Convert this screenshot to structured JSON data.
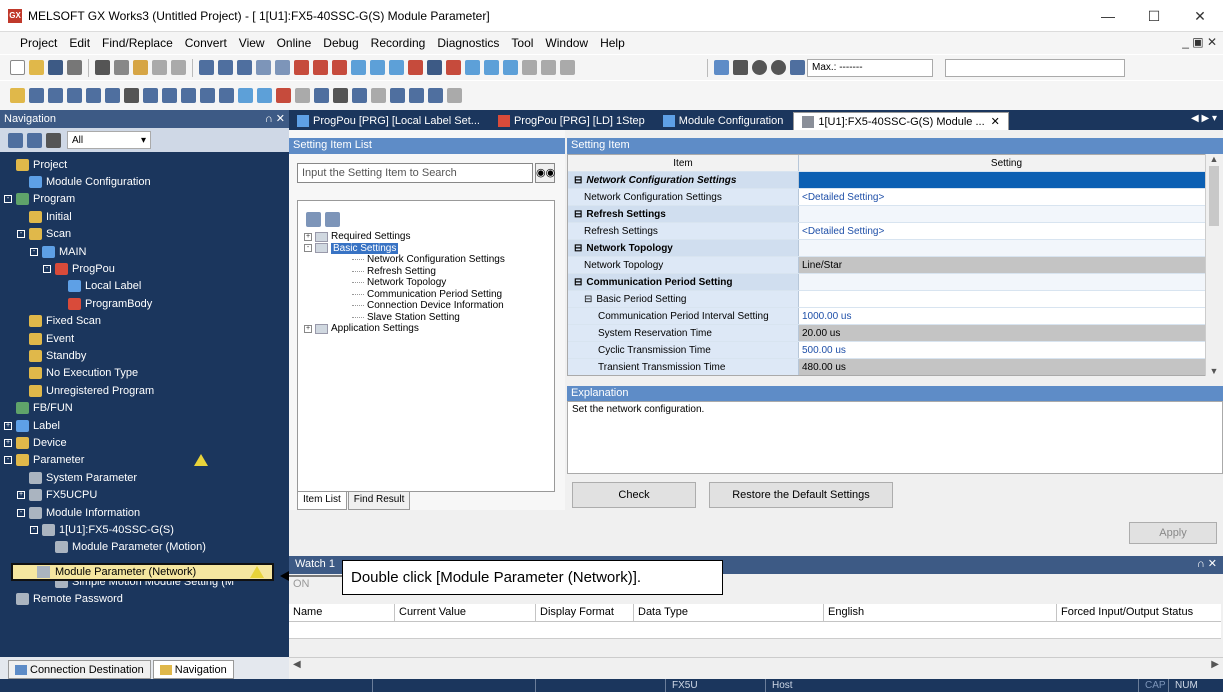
{
  "window": {
    "title": "MELSOFT GX Works3 (Untitled Project) - [ 1[U1]:FX5-40SSC-G(S) Module Parameter]",
    "app_icon": "GX"
  },
  "menu": [
    "Project",
    "Edit",
    "Find/Replace",
    "Convert",
    "View",
    "Online",
    "Debug",
    "Recording",
    "Diagnostics",
    "Tool",
    "Window",
    "Help"
  ],
  "toolbar": {
    "max_label": "Max.: -------"
  },
  "navigation": {
    "title": "Navigation",
    "filter": "All",
    "tree": [
      {
        "label": "Project",
        "level": 0
      },
      {
        "label": "Module Configuration",
        "level": 1
      },
      {
        "label": "Program",
        "level": 0,
        "exp": "-"
      },
      {
        "label": "Initial",
        "level": 1
      },
      {
        "label": "Scan",
        "level": 1,
        "exp": "-"
      },
      {
        "label": "MAIN",
        "level": 2,
        "exp": "-"
      },
      {
        "label": "ProgPou",
        "level": 3,
        "exp": "-"
      },
      {
        "label": "Local Label",
        "level": 4
      },
      {
        "label": "ProgramBody",
        "level": 4
      },
      {
        "label": "Fixed Scan",
        "level": 1
      },
      {
        "label": "Event",
        "level": 1
      },
      {
        "label": "Standby",
        "level": 1
      },
      {
        "label": "No Execution Type",
        "level": 1
      },
      {
        "label": "Unregistered Program",
        "level": 1
      },
      {
        "label": "FB/FUN",
        "level": 0
      },
      {
        "label": "Label",
        "level": 0,
        "exp": "+"
      },
      {
        "label": "Device",
        "level": 0,
        "exp": "+"
      },
      {
        "label": "Parameter",
        "level": 0,
        "exp": "-",
        "warn": true
      },
      {
        "label": "System Parameter",
        "level": 1
      },
      {
        "label": "FX5UCPU",
        "level": 1,
        "exp": "+"
      },
      {
        "label": "Module Information",
        "level": 1,
        "exp": "-"
      },
      {
        "label": "1[U1]:FX5-40SSC-G(S)",
        "level": 2,
        "exp": "-"
      },
      {
        "label": "Module Parameter (Motion)",
        "level": 3
      },
      {
        "label": "",
        "level": 3
      },
      {
        "label": "Simple Motion Module Setting (M",
        "level": 3
      },
      {
        "label": "Remote Password",
        "level": 0
      }
    ],
    "highlighted": "Module Parameter (Network)",
    "bottom_tabs": [
      "Connection Destination",
      "Navigation"
    ]
  },
  "doc_tabs": [
    {
      "label": "ProgPou [PRG] [Local Label Set..."
    },
    {
      "label": "ProgPou [PRG] [LD] 1Step"
    },
    {
      "label": "Module Configuration"
    },
    {
      "label": "1[U1]:FX5-40SSC-G(S) Module ...",
      "active": true
    }
  ],
  "setting_item_list": {
    "title": "Setting Item List",
    "search_placeholder": "Input the Setting Item to Search",
    "tree": [
      {
        "label": "Required Settings",
        "level": 0,
        "exp": "+"
      },
      {
        "label": "Basic Settings",
        "level": 0,
        "exp": "-",
        "selected": true
      },
      {
        "label": "Network Configuration Settings",
        "level": 1
      },
      {
        "label": "Refresh Setting",
        "level": 1
      },
      {
        "label": "Network Topology",
        "level": 1
      },
      {
        "label": "Communication Period Setting",
        "level": 1
      },
      {
        "label": "Connection Device Information",
        "level": 1
      },
      {
        "label": "Slave Station Setting",
        "level": 1
      },
      {
        "label": "Application Settings",
        "level": 0,
        "exp": "+"
      }
    ],
    "tabs": [
      "Item List",
      "Find Result"
    ]
  },
  "setting_item": {
    "title": "Setting Item",
    "col_item": "Item",
    "col_setting": "Setting",
    "rows": [
      {
        "item": "Network Configuration Settings",
        "setting": "",
        "type": "grp",
        "italic": true,
        "sel": true
      },
      {
        "item": "Network Configuration Settings",
        "setting": "<Detailed Setting>",
        "type": "sub"
      },
      {
        "item": "Refresh Settings",
        "setting": "",
        "type": "grp"
      },
      {
        "item": "Refresh Settings",
        "setting": "<Detailed Setting>",
        "type": "sub"
      },
      {
        "item": "Network Topology",
        "setting": "",
        "type": "grp"
      },
      {
        "item": "Network Topology",
        "setting": "Line/Star",
        "type": "sub",
        "gray": true
      },
      {
        "item": "Communication Period Setting",
        "setting": "",
        "type": "grp"
      },
      {
        "item": "Basic Period Setting",
        "setting": "",
        "type": "sub"
      },
      {
        "item": "Communication Period Interval Setting",
        "setting": "1000.00 us",
        "type": "sub2"
      },
      {
        "item": "System Reservation Time",
        "setting": "20.00 us",
        "type": "sub2",
        "gray": true
      },
      {
        "item": "Cyclic Transmission Time",
        "setting": "500.00 us",
        "type": "sub2"
      },
      {
        "item": "Transient Transmission Time",
        "setting": "480.00 us",
        "type": "sub2",
        "gray": true
      }
    ]
  },
  "explanation": {
    "title": "Explanation",
    "text": "Set the network configuration."
  },
  "buttons": {
    "check": "Check",
    "restore": "Restore the Default Settings",
    "apply": "Apply"
  },
  "watch": {
    "title": "Watch 1",
    "on_label": "ON",
    "columns": [
      "Name",
      "Current Value",
      "Display Format",
      "Data Type",
      "English",
      "Forced Input/Output Status"
    ]
  },
  "callout": "Double click [Module Parameter (Network)].",
  "status": {
    "cpu": "FX5U",
    "host": "Host",
    "cap": "CAP",
    "num": "NUM"
  },
  "colors": {
    "nav_bg": "#1b365d",
    "header_blue": "#5e8cc7",
    "highlight": "#f5e6a0"
  }
}
